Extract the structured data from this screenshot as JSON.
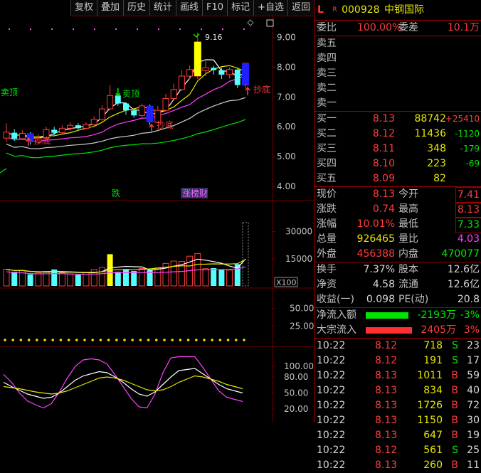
{
  "toolbar": [
    "复权",
    "叠加",
    "历史",
    "统计",
    "画线",
    "F10",
    "标记",
    "+自选",
    "返回"
  ],
  "colors": {
    "up": "#ff3c3c",
    "down": "#54ffff",
    "red": "#ff3c3c",
    "green": "#00e600",
    "yellow": "#e6e600",
    "magenta": "#ff40ff",
    "grid": "#6b0000"
  },
  "chart": {
    "price_ticks": [
      "9.00",
      "8.00",
      "7.00",
      "6.00",
      "5.00",
      "4.00"
    ],
    "high_label": "9.16",
    "signals": {
      "sell_left": "卖顶",
      "sell_mid": "卖顶",
      "buy_1": "抄底",
      "buy_2": "抄底",
      "buy_3": "抄底"
    },
    "tags": {
      "fall": "跌",
      "rank": "涨榜财"
    },
    "volume_ticks": [
      "30000",
      "15000"
    ],
    "volume_unit": "X100",
    "ind1_ticks": [
      "50.00",
      "25.00"
    ],
    "ind2_ticks": [
      "100.00",
      "80.00",
      "50.00",
      "20.00"
    ]
  },
  "chart_data": {
    "type": "candlestick",
    "price_ylim": [
      4.0,
      9.3
    ],
    "candles": [
      {
        "o": 5.62,
        "c": 5.82,
        "h": 6.12,
        "l": 5.5
      },
      {
        "o": 5.8,
        "c": 5.6,
        "h": 5.92,
        "l": 5.52
      },
      {
        "o": 5.6,
        "c": 5.78,
        "h": 5.88,
        "l": 5.55
      },
      {
        "o": 5.78,
        "c": 5.48,
        "h": 5.82,
        "l": 5.4
      },
      {
        "o": 5.48,
        "c": 5.62,
        "h": 5.75,
        "l": 5.44
      },
      {
        "o": 5.62,
        "c": 5.9,
        "h": 6.0,
        "l": 5.58
      },
      {
        "o": 5.9,
        "c": 5.8,
        "h": 6.0,
        "l": 5.72
      },
      {
        "o": 5.8,
        "c": 5.95,
        "h": 6.05,
        "l": 5.75
      },
      {
        "o": 5.95,
        "c": 6.05,
        "h": 6.15,
        "l": 5.88
      },
      {
        "o": 6.05,
        "c": 5.95,
        "h": 6.12,
        "l": 5.9
      },
      {
        "o": 5.95,
        "c": 6.08,
        "h": 6.15,
        "l": 5.92
      },
      {
        "o": 6.08,
        "c": 6.25,
        "h": 6.35,
        "l": 6.02
      },
      {
        "o": 6.25,
        "c": 6.6,
        "h": 6.72,
        "l": 6.2
      },
      {
        "o": 6.6,
        "c": 7.05,
        "h": 7.4,
        "l": 6.55
      },
      {
        "o": 7.05,
        "c": 6.78,
        "h": 7.12,
        "l": 6.7
      },
      {
        "o": 6.78,
        "c": 6.55,
        "h": 6.82,
        "l": 6.4
      },
      {
        "o": 6.55,
        "c": 6.38,
        "h": 6.6,
        "l": 6.3
      },
      {
        "o": 6.38,
        "c": 6.7,
        "h": 6.78,
        "l": 6.32
      },
      {
        "o": 6.7,
        "c": 6.15,
        "h": 6.75,
        "l": 6.05
      },
      {
        "o": 6.15,
        "c": 6.55,
        "h": 6.7,
        "l": 6.12
      },
      {
        "o": 6.55,
        "c": 6.95,
        "h": 7.1,
        "l": 6.5
      },
      {
        "o": 6.95,
        "c": 7.25,
        "h": 7.45,
        "l": 6.9
      },
      {
        "o": 7.25,
        "c": 7.7,
        "h": 7.9,
        "l": 7.2
      },
      {
        "o": 7.7,
        "c": 7.92,
        "h": 8.05,
        "l": 7.6
      },
      {
        "o": 7.7,
        "c": 8.85,
        "h": 9.16,
        "l": 7.6
      },
      {
        "o": 7.88,
        "c": 7.98,
        "h": 8.2,
        "l": 7.7
      },
      {
        "o": 7.98,
        "c": 7.9,
        "h": 8.05,
        "l": 7.75
      },
      {
        "o": 7.9,
        "c": 7.75,
        "h": 7.98,
        "l": 7.6
      },
      {
        "o": 7.75,
        "c": 7.92,
        "h": 8.0,
        "l": 7.62
      },
      {
        "o": 7.92,
        "c": 7.4,
        "h": 7.95,
        "l": 7.3
      },
      {
        "o": 7.4,
        "c": 8.13,
        "h": 8.13,
        "l": 7.3
      }
    ],
    "volume_ylim": [
      0,
      40000
    ],
    "volume": [
      9200,
      7800,
      8600,
      6400,
      7200,
      8000,
      9100,
      7300,
      6500,
      6200,
      7400,
      9000,
      10200,
      17500,
      7800,
      9300,
      8200,
      9600,
      8800,
      10100,
      12400,
      13700,
      13500,
      16400,
      17800,
      9500,
      9800,
      9000,
      8700,
      12000,
      35000
    ],
    "ind1_ylim": [
      0,
      70
    ],
    "ind1": [
      4,
      4,
      4,
      4,
      4,
      4,
      4,
      4,
      4,
      4,
      4,
      4,
      4,
      4,
      4,
      4,
      4,
      4,
      4,
      4,
      4,
      4,
      4,
      4,
      4,
      4,
      4,
      4,
      4,
      4,
      4
    ],
    "ind2_ylim": [
      0,
      120
    ],
    "ind2_k": [
      70,
      62,
      55,
      48,
      44,
      40,
      42,
      50,
      62,
      74,
      82,
      86,
      90,
      88,
      80,
      70,
      58,
      48,
      44,
      52,
      66,
      80,
      92,
      94,
      96,
      86,
      76,
      66,
      58,
      54,
      50
    ],
    "ind2_d": [
      62,
      60,
      58,
      55,
      52,
      50,
      48,
      50,
      54,
      60,
      66,
      72,
      78,
      80,
      78,
      74,
      68,
      62,
      56,
      54,
      56,
      62,
      70,
      76,
      82,
      80,
      76,
      72,
      66,
      62,
      58
    ],
    "ind2_j": [
      85,
      70,
      50,
      35,
      28,
      22,
      30,
      52,
      78,
      100,
      112,
      114,
      112,
      104,
      84,
      62,
      40,
      24,
      22,
      48,
      88,
      116,
      128,
      124,
      122,
      98,
      76,
      54,
      42,
      38,
      34
    ]
  },
  "quote": {
    "prefix_l": "L",
    "prefix_r": "R",
    "code": "000928",
    "name": "中钢国际",
    "weibi_label": "委比",
    "weibi_val": "100.00%",
    "weicha_label": "委差",
    "weicha_val": "10.1万",
    "sell": [
      {
        "label": "卖五",
        "price": "",
        "vol": "",
        "chg": ""
      },
      {
        "label": "卖四",
        "price": "",
        "vol": "",
        "chg": ""
      },
      {
        "label": "卖三",
        "price": "",
        "vol": "",
        "chg": ""
      },
      {
        "label": "卖二",
        "price": "",
        "vol": "",
        "chg": ""
      },
      {
        "label": "卖一",
        "price": "",
        "vol": "",
        "chg": ""
      }
    ],
    "buy": [
      {
        "label": "买一",
        "price": "8.13",
        "vol": "88742",
        "chg": "+25410"
      },
      {
        "label": "买二",
        "price": "8.12",
        "vol": "11436",
        "chg": "-1120"
      },
      {
        "label": "买三",
        "price": "8.11",
        "vol": "348",
        "chg": "-179"
      },
      {
        "label": "买四",
        "price": "8.10",
        "vol": "223",
        "chg": "-69"
      },
      {
        "label": "买五",
        "price": "8.09",
        "vol": "82",
        "chg": ""
      }
    ],
    "stats": [
      {
        "l1": "现价",
        "v1": "8.13",
        "l2": "今开",
        "v2": "7.41"
      },
      {
        "l1": "涨跌",
        "v1": "0.74",
        "l2": "最高",
        "v2": "8.13"
      },
      {
        "l1": "涨幅",
        "v1": "10.01%",
        "l2": "最低",
        "v2": "7.33"
      },
      {
        "l1": "总量",
        "v1": "926465",
        "l2": "量比",
        "v2": "4.03"
      },
      {
        "l1": "外盘",
        "v1": "456388",
        "l2": "内盘",
        "v2": "470077"
      }
    ],
    "stats2": [
      {
        "l1": "换手",
        "v1": "7.37%",
        "l2": "股本",
        "v2": "12.6亿"
      },
      {
        "l1": "净资",
        "v1": "4.58",
        "l2": "流通",
        "v2": "12.6亿"
      },
      {
        "l1": "收益(一)",
        "v1": "0.098",
        "l2": "PE(动)",
        "v2": "20.8"
      }
    ],
    "flow": [
      {
        "label": "净流入额",
        "bar": 0.6,
        "val": "-2193万",
        "pct": "-3%"
      },
      {
        "label": "大宗流入",
        "bar": 0.65,
        "val": "2405万",
        "pct": "3%"
      }
    ],
    "ticks": [
      {
        "t": "10:22",
        "p": "8.12",
        "v": "718",
        "s": "S",
        "n": "23"
      },
      {
        "t": "10:22",
        "p": "8.12",
        "v": "191",
        "s": "S",
        "n": "17"
      },
      {
        "t": "10:22",
        "p": "8.13",
        "v": "1011",
        "s": "B",
        "n": "59"
      },
      {
        "t": "10:22",
        "p": "8.13",
        "v": "834",
        "s": "B",
        "n": "40"
      },
      {
        "t": "10:22",
        "p": "8.13",
        "v": "1726",
        "s": "B",
        "n": "72"
      },
      {
        "t": "10:22",
        "p": "8.13",
        "v": "1150",
        "s": "B",
        "n": "30"
      },
      {
        "t": "10:22",
        "p": "8.13",
        "v": "647",
        "s": "B",
        "n": "19"
      },
      {
        "t": "10:22",
        "p": "8.12",
        "v": "561",
        "s": "S",
        "n": "25"
      },
      {
        "t": "10:22",
        "p": "8.13",
        "v": "260",
        "s": "B",
        "n": "11"
      }
    ]
  }
}
